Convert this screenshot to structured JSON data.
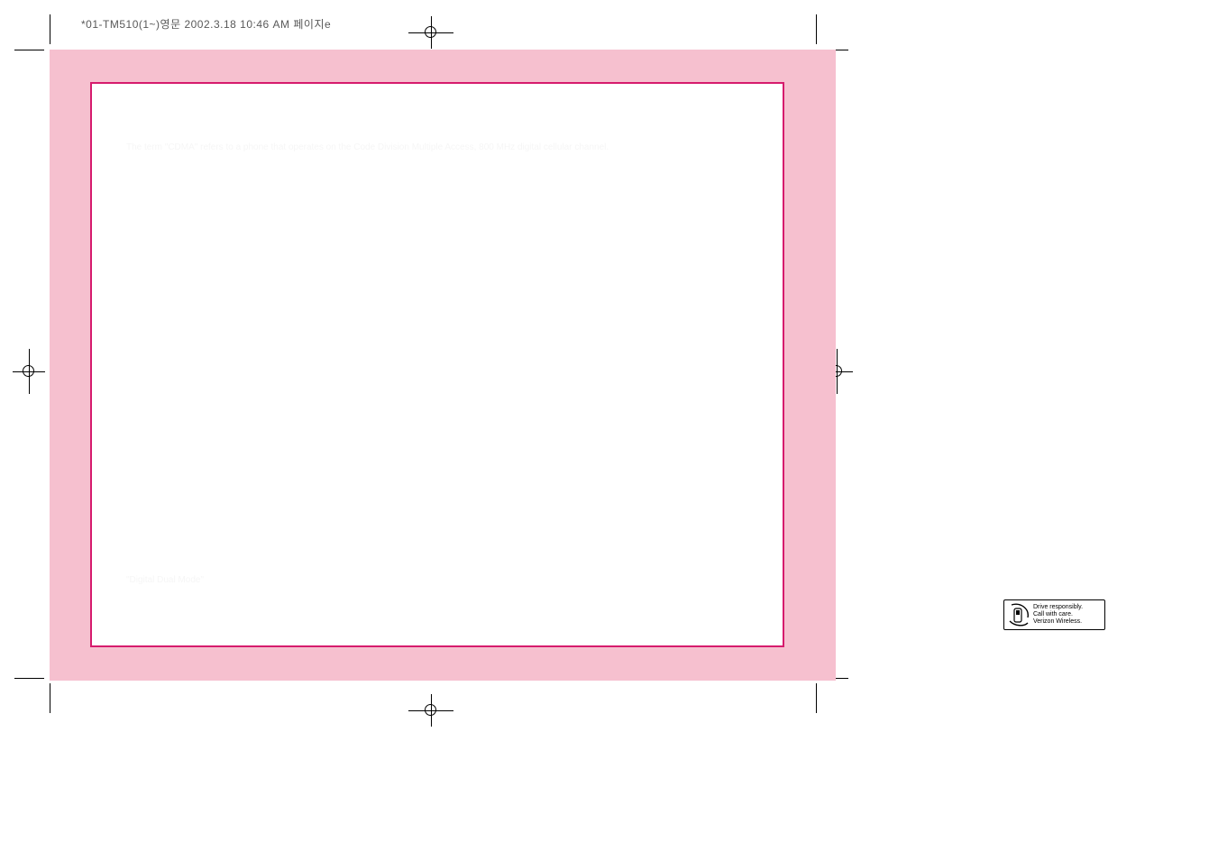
{
  "header": {
    "meta_line": "*01-TM510(1~)영문  2002.3.18 10:46 AM  페이지e"
  },
  "page": {
    "para1": "The term \"CDMA\" refers to a phone that operates on the Code Division Multiple Access, 800 MHz digital cellular channel.",
    "para2": "\"Digital Dual Mode\""
  },
  "logo": {
    "line1": "Drive responsibly.",
    "line2": "Call with care.",
    "line3": "Verizon Wireless."
  }
}
